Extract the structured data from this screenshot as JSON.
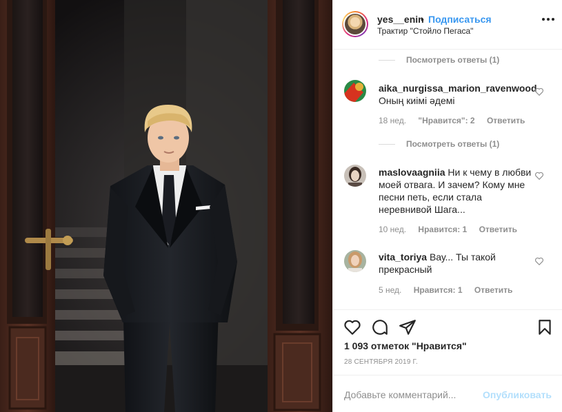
{
  "post": {
    "image_alt": "Man in black suit standing between open wooden doors"
  },
  "header": {
    "username": "yes__enin",
    "separator": "•",
    "follow_label": "Подписаться",
    "location": "Трактир \"Стойло Пегаса\""
  },
  "comments": {
    "view_replies_1": "Посмотреть ответы (1)",
    "items": [
      {
        "username": "aika_nurgissa_marion_ravenwood",
        "text": "Оның киімі әдемі",
        "time": "18 нед.",
        "likes": "\"Нравится\": 2",
        "reply": "Ответить"
      },
      {
        "username": "maslovaagniia",
        "text": "Ни к чему в любви моей отвага. И зачем? Кому мне песни петь, если стала неревнивой Шага...",
        "time": "10 нед.",
        "likes": "Нравится: 1",
        "reply": "Ответить"
      },
      {
        "username": "vita_toriya",
        "text": "Вау... Ты такой прекрасный",
        "time": "5 нед.",
        "likes": "Нравится: 1",
        "reply": "Ответить"
      }
    ],
    "view_replies_2": "Посмотреть ответы (1)"
  },
  "actions": {
    "like_icon": "heart-icon",
    "comment_icon": "comment-bubble-icon",
    "share_icon": "paper-plane-icon",
    "save_icon": "bookmark-icon",
    "likes_count": "1 093 отметок \"Нравится\"",
    "date": "28 СЕНТЯБРЯ 2019 Г."
  },
  "add_comment": {
    "placeholder": "Добавьте комментарий...",
    "publish_label": "Опубликовать"
  },
  "colors": {
    "accent": "#3897f0",
    "publish_disabled": "#b2dffc",
    "muted": "#8e8e8e",
    "text": "#262626"
  }
}
